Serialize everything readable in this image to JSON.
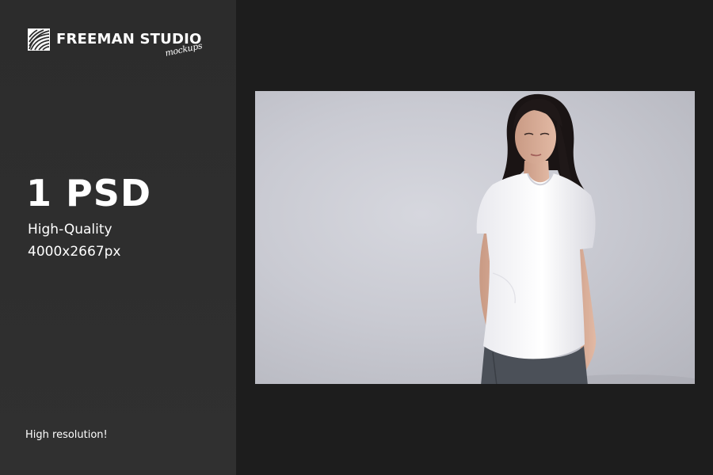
{
  "brand": {
    "logo_icon": "fingerprint-stripes-icon",
    "name": "FREEMAN STUDIO",
    "tagline": "mockups"
  },
  "hero": {
    "headline": "1 PSD",
    "quality": "High-Quality",
    "resolution": "4000x2667px"
  },
  "footer": {
    "note": "High resolution!"
  },
  "preview": {
    "subject": "model-in-white-tshirt-photo"
  },
  "colors": {
    "sidebar_bg": "#2e2e2e",
    "page_bg": "#1d1d1d",
    "photo_bg": "#c9cad2",
    "text": "#ffffff"
  }
}
